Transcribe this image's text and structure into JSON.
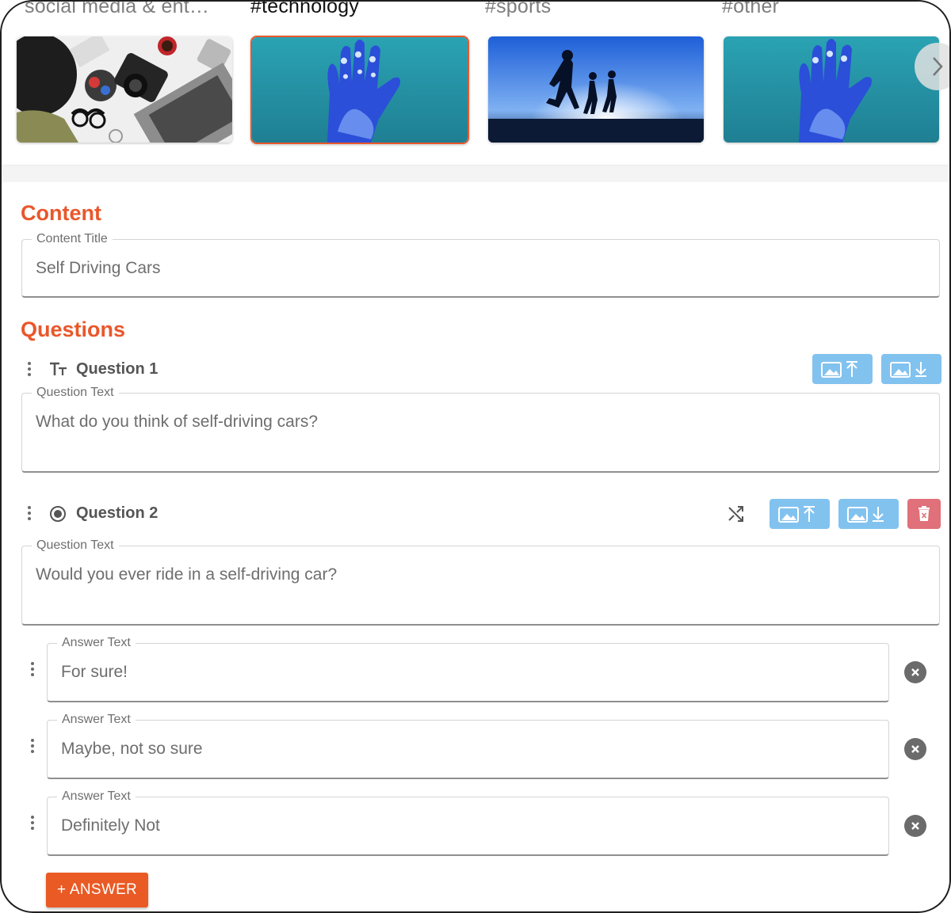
{
  "categories": [
    {
      "label": "social media & ent…",
      "selected": false,
      "image": "flat-lay of camera, laptop, glasses, coffee cup"
    },
    {
      "label": "#technology",
      "selected": true,
      "image": "blue robotic hand"
    },
    {
      "label": "#sports",
      "selected": false,
      "image": "silhouettes of runners"
    },
    {
      "label": "#other",
      "selected": false,
      "image": "blue robotic hand"
    }
  ],
  "content": {
    "heading": "Content",
    "title_legend": "Content Title",
    "title_value": "Self Driving Cars"
  },
  "questions_heading": "Questions",
  "questions": [
    {
      "label": "Question 1",
      "type_icon": "text-type-icon",
      "text_legend": "Question Text",
      "text_value": "What do you think of self-driving cars?"
    },
    {
      "label": "Question 2",
      "type_icon": "radio-type-icon",
      "text_legend": "Question Text",
      "text_value": "Would you ever ride in a self-driving car?",
      "answers": [
        {
          "legend": "Answer Text",
          "value": "For sure!"
        },
        {
          "legend": "Answer Text",
          "value": "Maybe, not so sure"
        },
        {
          "legend": "Answer Text",
          "value": "Definitely Not"
        }
      ]
    }
  ],
  "add_answer_label": "+ ANSWER",
  "colors": {
    "accent": "#e9572b",
    "image_button": "#82c2ef",
    "delete_button": "#e0707a",
    "add_button": "#ea5a24"
  }
}
